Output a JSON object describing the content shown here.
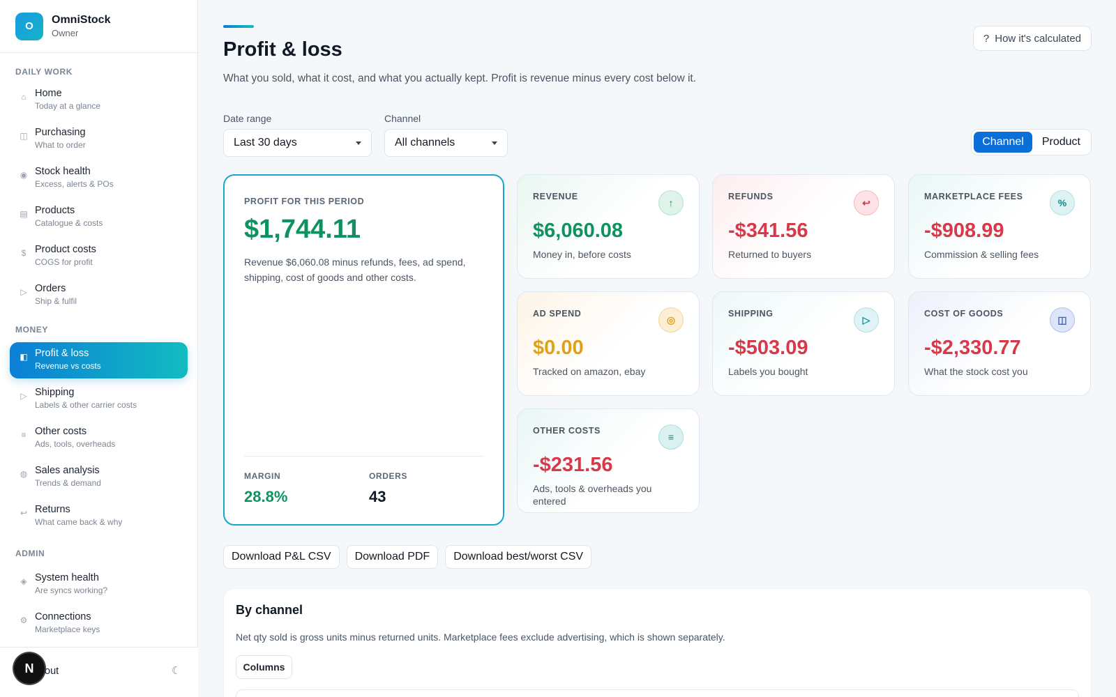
{
  "brand": {
    "initial": "O",
    "name": "OmniStock",
    "role": "Owner"
  },
  "sidebar": {
    "sections": [
      {
        "title": "DAILY WORK",
        "items": [
          {
            "icon": "⌂",
            "label": "Home",
            "sub": "Today at a glance"
          },
          {
            "icon": "◫",
            "label": "Purchasing",
            "sub": "What to order"
          },
          {
            "icon": "◉",
            "label": "Stock health",
            "sub": "Excess, alerts & POs"
          },
          {
            "icon": "▤",
            "label": "Products",
            "sub": "Catalogue & costs"
          },
          {
            "icon": "$",
            "label": "Product costs",
            "sub": "COGS for profit"
          },
          {
            "icon": "▷",
            "label": "Orders",
            "sub": "Ship & fulfil"
          }
        ]
      },
      {
        "title": "MONEY",
        "items": [
          {
            "icon": "◧",
            "label": "Profit & loss",
            "sub": "Revenue vs costs",
            "active": true
          },
          {
            "icon": "▷",
            "label": "Shipping",
            "sub": "Labels & other carrier costs"
          },
          {
            "icon": "≡",
            "label": "Other costs",
            "sub": "Ads, tools, overheads"
          },
          {
            "icon": "◍",
            "label": "Sales analysis",
            "sub": "Trends & demand"
          },
          {
            "icon": "↩",
            "label": "Returns",
            "sub": "What came back & why"
          }
        ]
      },
      {
        "title": "ADMIN",
        "items": [
          {
            "icon": "◈",
            "label": "System health",
            "sub": "Are syncs working?"
          },
          {
            "icon": "⚙",
            "label": "Connections",
            "sub": "Marketplace keys"
          }
        ]
      }
    ],
    "footer": {
      "logout_label": "out",
      "theme_icon": "☾",
      "avatar_initial": "N"
    }
  },
  "header": {
    "title": "Profit & loss",
    "subtitle": "What you sold, what it cost, and what you actually kept. Profit is revenue minus every cost below it.",
    "help_label": "How it's calculated"
  },
  "filters": {
    "date_range": {
      "label": "Date range",
      "value": "Last 30 days"
    },
    "channel": {
      "label": "Channel",
      "value": "All channels"
    }
  },
  "view_toggle": {
    "options": [
      "Channel",
      "Product"
    ],
    "selected": "Channel"
  },
  "profit": {
    "label": "PROFIT FOR THIS PERIOD",
    "value": "$1,744.11",
    "description": "Revenue $6,060.08 minus refunds, fees, ad spend, shipping, cost of goods and other costs.",
    "margin_label": "MARGIN",
    "margin_value": "28.8%",
    "orders_label": "ORDERS",
    "orders_value": "43"
  },
  "metrics": [
    {
      "label": "REVENUE",
      "value": "$6,060.08",
      "sub": "Money in, before costs",
      "icon": "↑",
      "color": "#0f9160"
    },
    {
      "label": "REFUNDS",
      "value": "-$341.56",
      "sub": "Returned to buyers",
      "icon": "↩",
      "color": "#d63a4a"
    },
    {
      "label": "MARKETPLACE FEES",
      "value": "-$908.99",
      "sub": "Commission & selling fees",
      "icon": "%",
      "color": "#d63a4a"
    },
    {
      "label": "AD SPEND",
      "value": "$0.00",
      "sub": "Tracked on amazon, ebay",
      "icon": "◎",
      "color": "#e0a11a"
    },
    {
      "label": "SHIPPING",
      "value": "-$503.09",
      "sub": "Labels you bought",
      "icon": "▷",
      "color": "#d63a4a"
    },
    {
      "label": "COST OF GOODS",
      "value": "-$2,330.77",
      "sub": "What the stock cost you",
      "icon": "◫",
      "color": "#d63a4a"
    },
    {
      "label": "OTHER COSTS",
      "value": "-$231.56",
      "sub": "Ads, tools & overheads you entered",
      "icon": "≡",
      "color": "#d63a4a"
    }
  ],
  "downloads": [
    "Download P&L CSV",
    "Download PDF",
    "Download best/worst CSV"
  ],
  "by_channel": {
    "title": "By channel",
    "description": "Net qty sold is gross units minus returned units. Marketplace fees exclude advertising, which is shown separately.",
    "columns_label": "Columns"
  }
}
